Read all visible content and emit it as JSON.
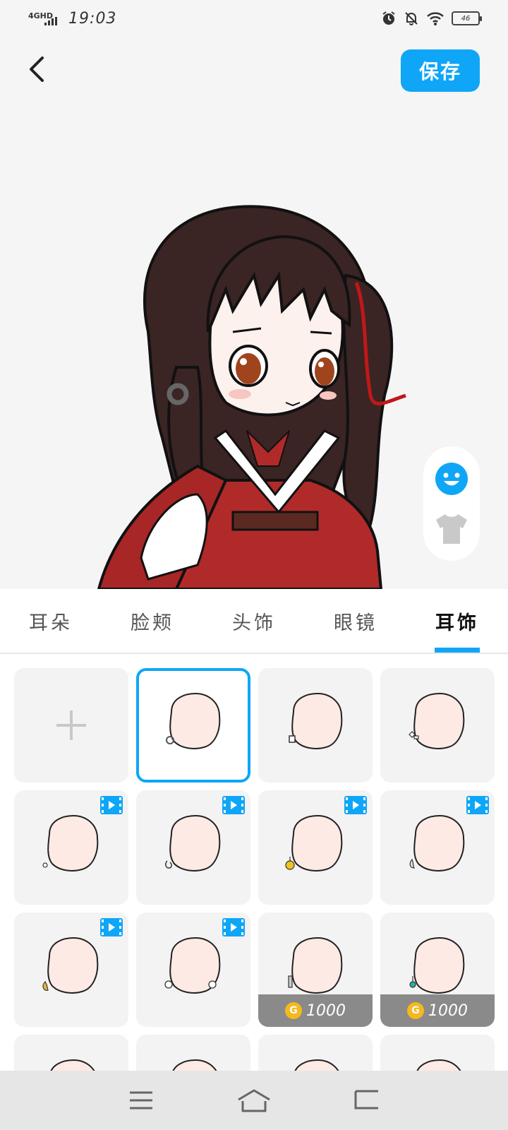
{
  "status_bar": {
    "network": "4GHD",
    "time": "19:03",
    "battery": "46"
  },
  "header": {
    "save_label": "保存"
  },
  "side_tools": [
    "face-icon",
    "shirt-icon"
  ],
  "tabs": [
    {
      "label": "耳朵",
      "active": false
    },
    {
      "label": "脸颊",
      "active": false
    },
    {
      "label": "头饰",
      "active": false
    },
    {
      "label": "眼镜",
      "active": false
    },
    {
      "label": "耳饰",
      "active": true
    }
  ],
  "grid_items": [
    {
      "type": "add"
    },
    {
      "type": "earring",
      "selected": true,
      "accessory": "hoop-silver"
    },
    {
      "type": "earring",
      "accessory": "square-stud"
    },
    {
      "type": "earring",
      "accessory": "diamond-stud"
    },
    {
      "type": "earring",
      "video": true,
      "accessory": "small-ring"
    },
    {
      "type": "earring",
      "video": true,
      "accessory": "chain"
    },
    {
      "type": "earring",
      "video": true,
      "accessory": "gold-drop"
    },
    {
      "type": "earring",
      "video": true,
      "accessory": "silver-drop"
    },
    {
      "type": "earring",
      "video": true,
      "accessory": "gold-hoop"
    },
    {
      "type": "earring",
      "video": true,
      "accessory": "double-hoop"
    },
    {
      "type": "earring",
      "price": "1000",
      "accessory": "silver-bar"
    },
    {
      "type": "earring",
      "price": "1000",
      "accessory": "teal-drop"
    },
    {
      "type": "earring"
    },
    {
      "type": "earring"
    },
    {
      "type": "earring"
    },
    {
      "type": "earring"
    }
  ],
  "colors": {
    "accent": "#0fa6f7",
    "coin": "#f6b81c",
    "price_bg": "#8a8a8a"
  }
}
